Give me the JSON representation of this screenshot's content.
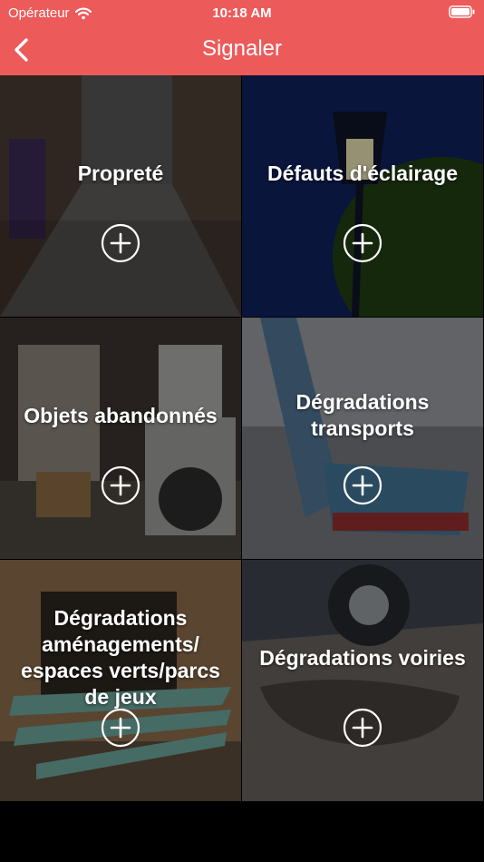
{
  "status_bar": {
    "carrier": "Opérateur",
    "time": "10:18 AM",
    "wifi_icon": "wifi-icon",
    "battery_icon": "battery-icon"
  },
  "header": {
    "title": "Signaler",
    "back_icon": "chevron-left-icon",
    "background": "#ED5A5A"
  },
  "categories": [
    {
      "label": "Propreté",
      "icon": "plus-circle-icon"
    },
    {
      "label": "Défauts d'éclairage",
      "icon": "plus-circle-icon"
    },
    {
      "label": "Objets abandonnés",
      "icon": "plus-circle-icon"
    },
    {
      "label": "Dégradations transports",
      "icon": "plus-circle-icon"
    },
    {
      "label": "Dégradations aménagements/ espaces verts/parcs de jeux",
      "icon": "plus-circle-icon"
    },
    {
      "label": "Dégradations voiries",
      "icon": "plus-circle-icon"
    }
  ]
}
